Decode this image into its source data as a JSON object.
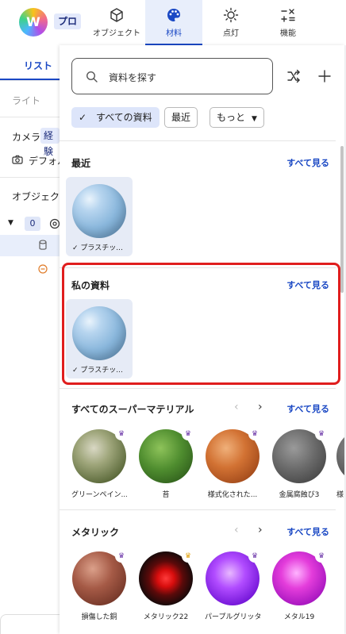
{
  "app": {
    "plan_badge": "プロ"
  },
  "nav": {
    "tabs": [
      {
        "label": "オブジェクト",
        "icon": "cube-icon",
        "active": false
      },
      {
        "label": "材料",
        "icon": "palette-icon",
        "active": true
      },
      {
        "label": "点灯",
        "icon": "sun-icon",
        "active": false
      },
      {
        "label": "機能",
        "icon": "math-icon",
        "active": false
      }
    ]
  },
  "left_panel": {
    "tab_label": "リスト",
    "light_label": "ライト",
    "camera_label": "カメラ",
    "camera_chip": "経験",
    "default_label": "デフォル",
    "objects_label": "オブジェクト",
    "count": "0"
  },
  "material_panel": {
    "search_placeholder": "資料を探す",
    "filters": {
      "all": "すべての資料",
      "recent": "最近",
      "more": "もっと"
    },
    "sections": {
      "recent": {
        "title": "最近",
        "see_all": "すべて見る",
        "items": [
          {
            "name": "プラスチッ..."
          }
        ]
      },
      "mine": {
        "title": "私の資料",
        "see_all": "すべて見る",
        "items": [
          {
            "name": "プラスチッ..."
          }
        ]
      },
      "super": {
        "title": "すべてのスーパーマテリアル",
        "see_all": "すべて見る",
        "items": [
          {
            "name": "グリーンペイン...",
            "badge": "crown-purple"
          },
          {
            "name": "苔",
            "badge": "crown-purple"
          },
          {
            "name": "様式化された...",
            "badge": "crown-purple"
          },
          {
            "name": "金属腐蝕び3",
            "badge": "crown-purple"
          },
          {
            "name": "様",
            "badge": ""
          }
        ]
      },
      "metallic": {
        "title": "メタリック",
        "see_all": "すべて見る",
        "items": [
          {
            "name": "損傷した銅",
            "badge": "crown-purple"
          },
          {
            "name": "メタリック22",
            "badge": "crown-gold"
          },
          {
            "name": "パープルグリッター",
            "badge": "crown-purple"
          },
          {
            "name": "メタル19",
            "badge": "crown-purple"
          }
        ]
      }
    }
  },
  "colors": {
    "accent": "#1a48c4",
    "highlight_border": "#e01e1e",
    "chip_selected": "#dde5fa"
  }
}
